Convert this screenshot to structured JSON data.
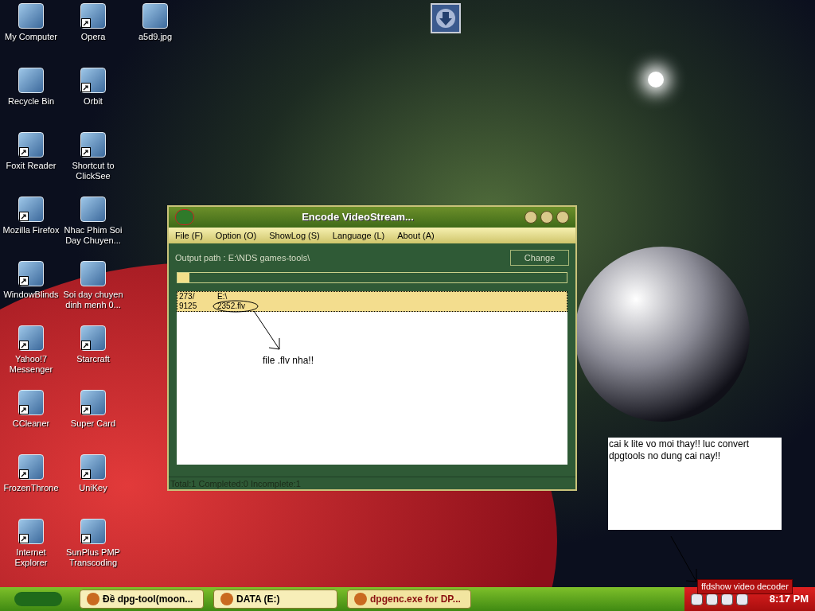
{
  "desktop_icons": [
    {
      "label": "My Computer",
      "shortcut": false
    },
    {
      "label": "Recycle Bin",
      "shortcut": false
    },
    {
      "label": "Foxit Reader",
      "shortcut": true
    },
    {
      "label": "Mozilla Firefox",
      "shortcut": true
    },
    {
      "label": "WindowBlinds",
      "shortcut": true
    },
    {
      "label": "Yahoo!7 Messenger",
      "shortcut": true
    },
    {
      "label": "CCleaner",
      "shortcut": true
    },
    {
      "label": "FrozenThrone",
      "shortcut": true
    },
    {
      "label": "Internet Explorer",
      "shortcut": true
    },
    {
      "label": "Opera",
      "shortcut": true
    },
    {
      "label": "Orbit",
      "shortcut": true
    },
    {
      "label": "Shortcut to ClickSee",
      "shortcut": true
    },
    {
      "label": "Nhac Phim Soi Day Chuyen...",
      "shortcut": false
    },
    {
      "label": "Soi day chuyen dinh menh 0...",
      "shortcut": false
    },
    {
      "label": "Starcraft",
      "shortcut": true
    },
    {
      "label": "Super Card",
      "shortcut": true
    },
    {
      "label": "UniKey",
      "shortcut": true
    },
    {
      "label": "SunPlus PMP Transcoding",
      "shortcut": true
    },
    {
      "label": "a5d9.jpg",
      "shortcut": false
    }
  ],
  "window": {
    "title": "Encode VideoStream...",
    "menu": [
      "File (F)",
      "Option (O)",
      "ShowLog (S)",
      "Language (L)",
      "About (A)"
    ],
    "output_path": "Output path : E:\\NDS games-tools\\",
    "change_button": "Change",
    "progress": {
      "level": 0.03
    },
    "rows": [
      {
        "column_1": [
          "273/",
          "9125"
        ],
        "column_2": [
          "E:\\",
          "2352.flv"
        ],
        "selected": true
      }
    ],
    "annotation": "file .flv nha!!",
    "status_bar": "Total:1 Completed:0 Incomplete:1"
  },
  "note": "cai k lite vo moi thay!! luc convert dpgtools no dung cai nay!!",
  "taskbar": {
    "buttons": [
      {
        "label": "Đề dpg-tool(moon...",
        "active": false
      },
      {
        "label": "DATA (E:)",
        "active": false
      },
      {
        "label": "dpgenc.exe for DP...",
        "active": true
      }
    ],
    "tooltip": "ffdshow video decoder",
    "clock": "8:17 PM"
  }
}
